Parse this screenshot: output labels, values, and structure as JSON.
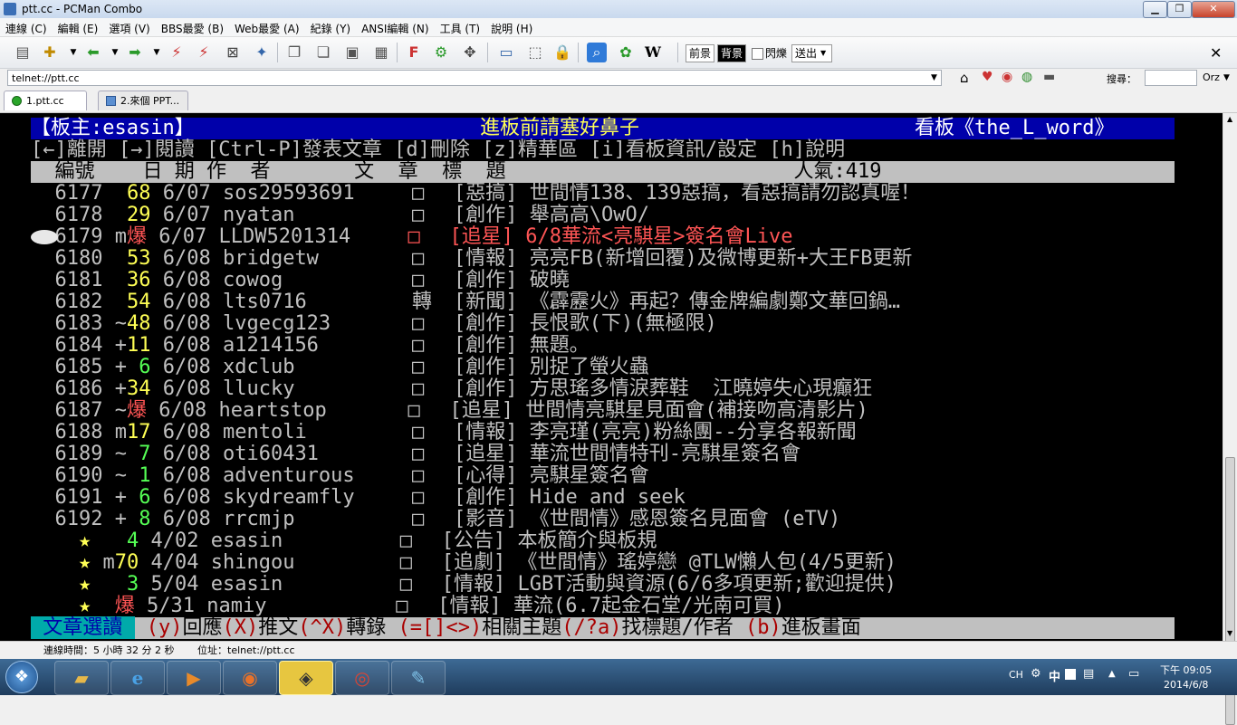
{
  "window": {
    "title": "ptt.cc - PCMan Combo",
    "minimize": "0",
    "maximize": "1",
    "close": "r"
  },
  "menu": [
    "連線 (C)",
    "編輯 (E)",
    "選項 (V)",
    "BBS最愛 (B)",
    "Web最愛 (A)",
    "紀錄 (Y)",
    "ANSI編輯 (N)",
    "工具 (T)",
    "說明 (H)"
  ],
  "toolbar": {
    "fg_label": "前景",
    "bg_label": "背景",
    "blink_label": "閃爍",
    "send_label": "送出",
    "search_label": "搜尋：",
    "search_engine": "Orz"
  },
  "address": {
    "value": "telnet://ptt.cc"
  },
  "tabs": [
    {
      "label": "1.ptt.cc"
    },
    {
      "label": "2.來個 PPT..."
    }
  ],
  "terminal": {
    "header": {
      "moderator": "【板主:esasin】",
      "slogan": "進板前請塞好鼻子",
      "board": "看板《the_L_word》"
    },
    "helpline": "[←]離開 [→]閱讀 [Ctrl-P]發表文章 [d]刪除 [z]精華區 [i]看板資訊/設定 [h]說明",
    "columns": "  編號    日 期 作  者       文  章  標  題                        人氣:419 ",
    "rows": [
      {
        "num": "6177",
        "flag": " ",
        "push": "68",
        "push_color": "#ffff55",
        "date": "6/07",
        "author": "sos29593691",
        "mark": "□",
        "cat": "[惡搞]",
        "title": "世間情138、139惡搞，看惡搞請勿認真喔！",
        "sel": false
      },
      {
        "num": "6178",
        "flag": " ",
        "push": "29",
        "push_color": "#ffff55",
        "date": "6/07",
        "author": "nyatan",
        "mark": "□",
        "cat": "[創作]",
        "title": "舉高高\\OwO/",
        "sel": false
      },
      {
        "num": "6179",
        "flag": "m",
        "push": "爆",
        "push_color": "#ff5555",
        "date": "6/07",
        "author": "LLDW5201314",
        "mark": "□",
        "cat": "[追星]",
        "title": "6/8華流<亮騏星>簽名會Live",
        "sel": true
      },
      {
        "num": "6180",
        "flag": " ",
        "push": "53",
        "push_color": "#ffff55",
        "date": "6/08",
        "author": "bridgetw",
        "mark": "□",
        "cat": "[情報]",
        "title": "亮亮FB(新增回覆)及微博更新+大王FB更新",
        "sel": false
      },
      {
        "num": "6181",
        "flag": " ",
        "push": "36",
        "push_color": "#ffff55",
        "date": "6/08",
        "author": "cowog",
        "mark": "□",
        "cat": "[創作]",
        "title": "破曉",
        "sel": false
      },
      {
        "num": "6182",
        "flag": " ",
        "push": "54",
        "push_color": "#ffff55",
        "date": "6/08",
        "author": "lts0716",
        "mark": "轉",
        "cat": "[新聞]",
        "title": "《霹靂火》再起？傳金牌編劇鄭文華回鍋…",
        "sel": false
      },
      {
        "num": "6183",
        "flag": "~",
        "push": "48",
        "push_color": "#ffff55",
        "date": "6/08",
        "author": "lvgecg123",
        "mark": "□",
        "cat": "[創作]",
        "title": "長恨歌(下)(無極限)",
        "sel": false
      },
      {
        "num": "6184",
        "flag": "+",
        "push": "11",
        "push_color": "#ffff55",
        "date": "6/08",
        "author": "a1214156",
        "mark": "□",
        "cat": "[創作]",
        "title": "無題。",
        "sel": false
      },
      {
        "num": "6185",
        "flag": "+",
        "push": " 6",
        "push_color": "#55ff55",
        "date": "6/08",
        "author": "xdclub",
        "mark": "□",
        "cat": "[創作]",
        "title": "別捉了螢火蟲",
        "sel": false
      },
      {
        "num": "6186",
        "flag": "+",
        "push": "34",
        "push_color": "#ffff55",
        "date": "6/08",
        "author": "llucky",
        "mark": "□",
        "cat": "[創作]",
        "title": "方思瑤多情淚葬鞋  江曉婷失心現癲狂",
        "sel": false
      },
      {
        "num": "6187",
        "flag": "~",
        "push": "爆",
        "push_color": "#ff5555",
        "date": "6/08",
        "author": "heartstop",
        "mark": "□",
        "cat": "[追星]",
        "title": "世間情亮騏星見面會(補接吻高清影片)",
        "sel": false
      },
      {
        "num": "6188",
        "flag": "m",
        "push": "17",
        "push_color": "#ffff55",
        "date": "6/08",
        "author": "mentoli",
        "mark": "□",
        "cat": "[情報]",
        "title": "李亮瑾(亮亮)粉絲團--分享各報新聞",
        "sel": false
      },
      {
        "num": "6189",
        "flag": "~",
        "push": " 7",
        "push_color": "#55ff55",
        "date": "6/08",
        "author": "oti60431",
        "mark": "□",
        "cat": "[追星]",
        "title": "華流世間情特刊-亮騏星簽名會",
        "sel": false
      },
      {
        "num": "6190",
        "flag": "~",
        "push": " 1",
        "push_color": "#55ff55",
        "date": "6/08",
        "author": "adventurous",
        "mark": "□",
        "cat": "[心得]",
        "title": "亮騏星簽名會",
        "sel": false
      },
      {
        "num": "6191",
        "flag": "+",
        "push": " 6",
        "push_color": "#55ff55",
        "date": "6/08",
        "author": "skydreamfly",
        "mark": "□",
        "cat": "[創作]",
        "title": "Hide and seek",
        "sel": false
      },
      {
        "num": "6192",
        "flag": "+",
        "push": " 8",
        "push_color": "#55ff55",
        "date": "6/08",
        "author": "rrcmjp",
        "mark": "□",
        "cat": "[影音]",
        "title": "《世間情》感恩簽名見面會 (eTV)",
        "sel": false
      },
      {
        "num": "  ★",
        "flag": " ",
        "push": " 4",
        "push_color": "#55ff55",
        "date": "4/02",
        "author": "esasin",
        "mark": "□",
        "cat": "[公告]",
        "title": "本板簡介與板規",
        "sel": false
      },
      {
        "num": "  ★",
        "flag": "m",
        "push": "70",
        "push_color": "#ffff55",
        "date": "4/04",
        "author": "shingou",
        "mark": "□",
        "cat": "[追劇]",
        "title": "《世間情》瑤婷戀 @TLW懶人包(4/5更新)",
        "sel": false
      },
      {
        "num": "  ★",
        "flag": " ",
        "push": " 3",
        "push_color": "#55ff55",
        "date": "5/04",
        "author": "esasin",
        "mark": "□",
        "cat": "[情報]",
        "title": "LGBT活動與資源(6/6多項更新;歡迎提供)",
        "sel": false
      },
      {
        "num": "  ★",
        "flag": " ",
        "push": "爆",
        "push_color": "#ff5555",
        "date": "5/31",
        "author": "namiy",
        "mark": "□",
        "cat": "[情報]",
        "title": "華流(6.7起金石堂/光南可買)",
        "sel": false
      }
    ],
    "footer": {
      "label": " 文章選讀 ",
      "items": [
        {
          "key": " (y)",
          "text": "回應"
        },
        {
          "key": "(X)",
          "text": "推文"
        },
        {
          "key": "(^X)",
          "text": "轉錄 "
        },
        {
          "key": "(=[]<>)",
          "text": "相關主題"
        },
        {
          "key": "(/?a)",
          "text": "找標題/作者 "
        },
        {
          "key": "(b)",
          "text": "進板畫面"
        }
      ]
    }
  },
  "status": {
    "conn_time": "連線時間：5 小時 32 分 2 秒",
    "addr": "位址：telnet://ptt.cc"
  },
  "taskbar": {
    "lang": "CH",
    "ime": "中",
    "time": "下午 09:05",
    "date": "2014/6/8"
  },
  "colors": {
    "terminal_bg": "#000000",
    "header_bg": "#0000aa",
    "columns_bg": "#c0c0c0",
    "footer_label_bg": "#00aaaa",
    "selected": "#ff5555",
    "star": "#ffff55"
  }
}
